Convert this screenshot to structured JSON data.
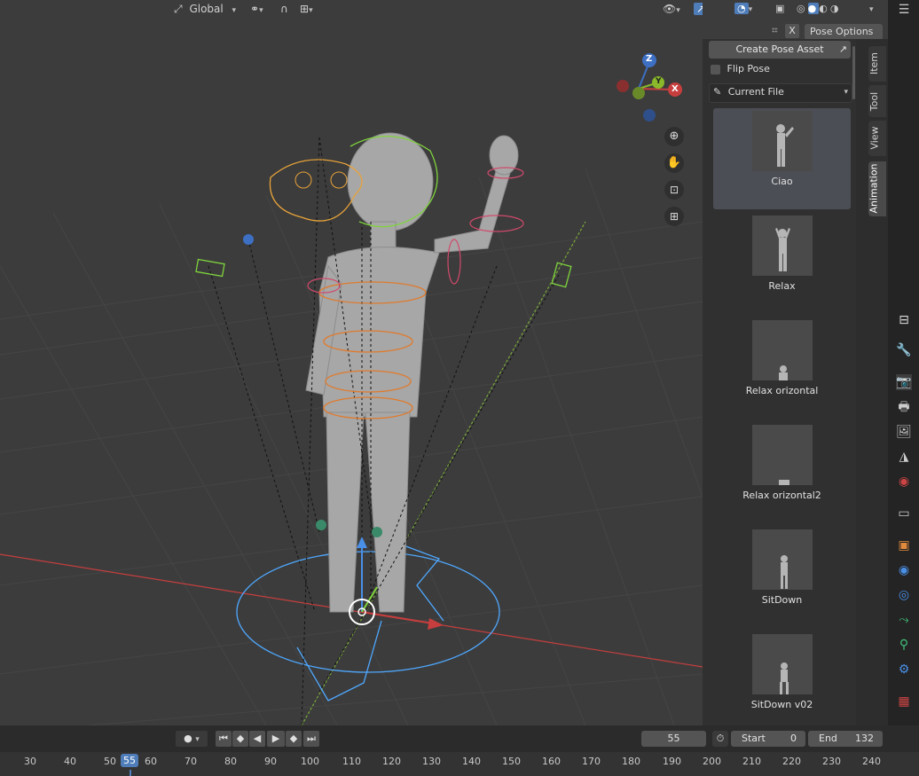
{
  "header": {
    "transform_orientation": "Global",
    "pose_options_label": "Pose Options",
    "close_label": "X"
  },
  "npanel": {
    "create_pose_asset_label": "Create Pose Asset",
    "flip_pose_label": "Flip Pose",
    "library_select_value": "Current File",
    "assets": [
      {
        "label": "Ciao",
        "active": true
      },
      {
        "label": "Relax",
        "active": false
      },
      {
        "label": "Relax orizontal",
        "active": false
      },
      {
        "label": "Relax orizontal2",
        "active": false
      },
      {
        "label": "SitDown",
        "active": false
      },
      {
        "label": "SitDown v02",
        "active": false
      }
    ],
    "tabs": [
      "Item",
      "Tool",
      "View",
      "Animation"
    ],
    "active_tab": "Animation"
  },
  "gizmo": {
    "x": "X",
    "y": "Y",
    "z": "Z"
  },
  "timeline": {
    "current_frame": "55",
    "start_label": "Start",
    "start_value": "0",
    "end_label": "End",
    "end_value": "132",
    "ruler_ticks": [
      "30",
      "40",
      "50",
      "55",
      "60",
      "70",
      "80",
      "90",
      "100",
      "110",
      "120",
      "130",
      "140",
      "150",
      "160",
      "170",
      "180",
      "190",
      "200",
      "210",
      "220",
      "230",
      "240"
    ]
  },
  "colors": {
    "axis_x": "#c73e3e",
    "axis_y": "#8ab82a",
    "axis_z": "#3d6fc2",
    "selection_blue": "#4fa8ff",
    "bone_orange": "#e07a2c"
  }
}
